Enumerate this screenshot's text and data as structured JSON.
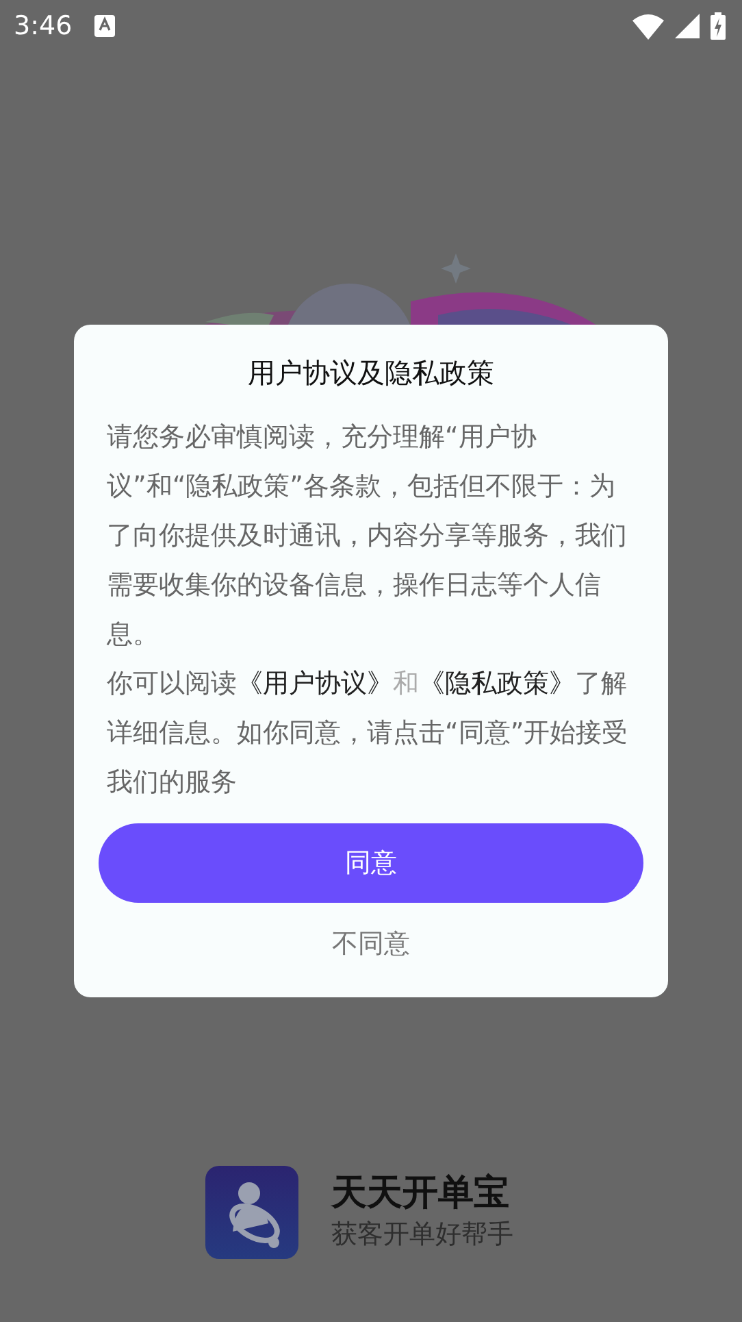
{
  "status_bar": {
    "time": "3:46"
  },
  "dialog": {
    "title": "用户协议及隐私政策",
    "paragraphs": [
      [
        {
          "kind": "text",
          "text": "请您务必审慎阅读，充分理解“用户协议”和“隐私政策”各条款，包括但不限于：为了向你提供及时通讯，内容分享等服务，我们需要收集你的设备信息，操作日志等个人信息。"
        }
      ],
      [
        {
          "kind": "text",
          "text": "你可以阅读"
        },
        {
          "kind": "link",
          "text": "《用户协议》"
        },
        {
          "kind": "muted",
          "text": "和"
        },
        {
          "kind": "link",
          "text": "《隐私政策》"
        },
        {
          "kind": "text",
          "text": "了解详细信息。如你同意，请点击“同意”开始接受我们的服务"
        }
      ]
    ],
    "buttons": [
      {
        "kind": "primary",
        "label": "同意"
      },
      {
        "kind": "plain",
        "label": "不同意"
      }
    ]
  },
  "app": {
    "name": "天天开单宝",
    "slogan": "获客开单好帮手"
  }
}
